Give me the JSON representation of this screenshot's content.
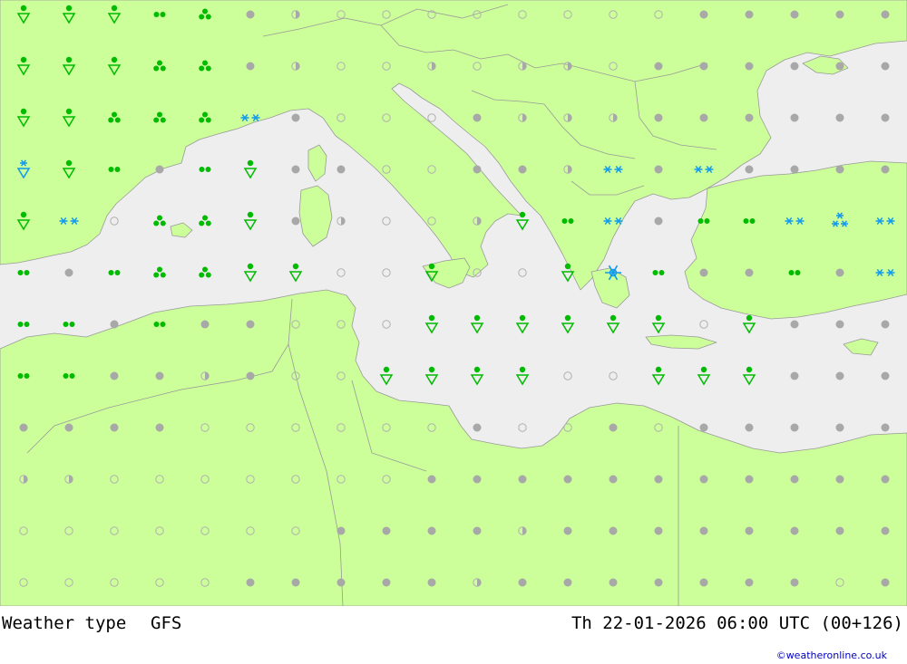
{
  "title": "Weather type",
  "model": "GFS",
  "valid_time": "Th 22-01-2026 06:00 UTC (00+126)",
  "credit": "©weatheronline.co.uk",
  "colors": {
    "land": "#ccff99",
    "sea": "#eeeeee",
    "border": "#999999",
    "rain": "#00bb00",
    "snow": "#1199ee",
    "cloud_full": "#a8a8a8",
    "cloud_outline": "#b0b0b0"
  },
  "symbol_grid": {
    "rows": [
      [
        "rain-drop",
        "rain-drop",
        "rain-drop",
        "drizzle",
        "showers",
        "overcast",
        "partly",
        "clear",
        "clear",
        "clear",
        "clear",
        "clear",
        "clear",
        "clear",
        "clear",
        "overcast",
        "overcast",
        "overcast",
        "overcast",
        "overcast"
      ],
      [
        "rain-drop",
        "rain-drop",
        "rain-drop",
        "showers",
        "showers",
        "overcast",
        "partly",
        "clear",
        "clear",
        "partly",
        "clear",
        "partly",
        "partly",
        "clear",
        "overcast",
        "overcast",
        "overcast",
        "overcast",
        "overcast",
        "overcast"
      ],
      [
        "rain-drop",
        "rain-drop",
        "showers",
        "showers",
        "showers",
        "snow",
        "overcast",
        "clear",
        "clear",
        "clear",
        "overcast",
        "partly",
        "partly",
        "partly",
        "overcast",
        "overcast",
        "overcast",
        "overcast",
        "overcast",
        "overcast"
      ],
      [
        "snow-rain",
        "rain-drop",
        "drizzle",
        "overcast",
        "drizzle",
        "rain-drop",
        "overcast",
        "overcast",
        "clear",
        "clear",
        "overcast",
        "overcast",
        "partly",
        "snow",
        "overcast",
        "snow",
        "overcast",
        "overcast",
        "overcast",
        "overcast"
      ],
      [
        "rain-drop",
        "snow",
        "clear",
        "showers",
        "showers",
        "rain-drop",
        "overcast",
        "partly",
        "clear",
        "clear",
        "partly",
        "rain-drop",
        "drizzle",
        "snow",
        "overcast",
        "drizzle",
        "drizzle",
        "snow",
        "heavy-snow",
        "snow"
      ],
      [
        "drizzle",
        "overcast",
        "drizzle",
        "showers",
        "showers",
        "rain-drop",
        "rain-drop",
        "clear",
        "clear",
        "rain-drop",
        "clear",
        "clear",
        "rain-drop",
        "flake",
        "drizzle",
        "overcast",
        "overcast",
        "drizzle",
        "overcast",
        "snow"
      ],
      [
        "drizzle",
        "drizzle",
        "overcast",
        "drizzle",
        "overcast",
        "overcast",
        "clear",
        "clear",
        "clear",
        "rain-drop",
        "rain-drop",
        "rain-drop",
        "rain-drop",
        "rain-drop",
        "rain-drop",
        "clear",
        "rain-drop",
        "overcast",
        "overcast",
        "overcast"
      ],
      [
        "drizzle",
        "drizzle",
        "overcast",
        "overcast",
        "partly",
        "overcast",
        "clear",
        "clear",
        "rain-drop",
        "rain-drop",
        "rain-drop",
        "rain-drop",
        "clear",
        "clear",
        "rain-drop",
        "rain-drop",
        "rain-drop",
        "overcast",
        "overcast",
        "overcast"
      ],
      [
        "overcast",
        "overcast",
        "overcast",
        "overcast",
        "clear",
        "clear",
        "clear",
        "clear",
        "clear",
        "clear",
        "overcast",
        "clear",
        "clear",
        "overcast",
        "clear",
        "overcast",
        "overcast",
        "overcast",
        "overcast",
        "overcast"
      ],
      [
        "partly",
        "partly",
        "clear",
        "clear",
        "clear",
        "clear",
        "clear",
        "clear",
        "clear",
        "overcast",
        "overcast",
        "overcast",
        "overcast",
        "overcast",
        "overcast",
        "overcast",
        "overcast",
        "overcast",
        "overcast",
        "overcast"
      ],
      [
        "clear",
        "clear",
        "clear",
        "clear",
        "clear",
        "clear",
        "clear",
        "overcast",
        "overcast",
        "overcast",
        "overcast",
        "partly",
        "overcast",
        "overcast",
        "overcast",
        "overcast",
        "overcast",
        "overcast",
        "overcast",
        "overcast"
      ],
      [
        "clear",
        "clear",
        "clear",
        "clear",
        "clear",
        "overcast",
        "overcast",
        "overcast",
        "overcast",
        "overcast",
        "partly",
        "overcast",
        "overcast",
        "overcast",
        "overcast",
        "overcast",
        "overcast",
        "overcast",
        "clear",
        "overcast"
      ]
    ]
  }
}
